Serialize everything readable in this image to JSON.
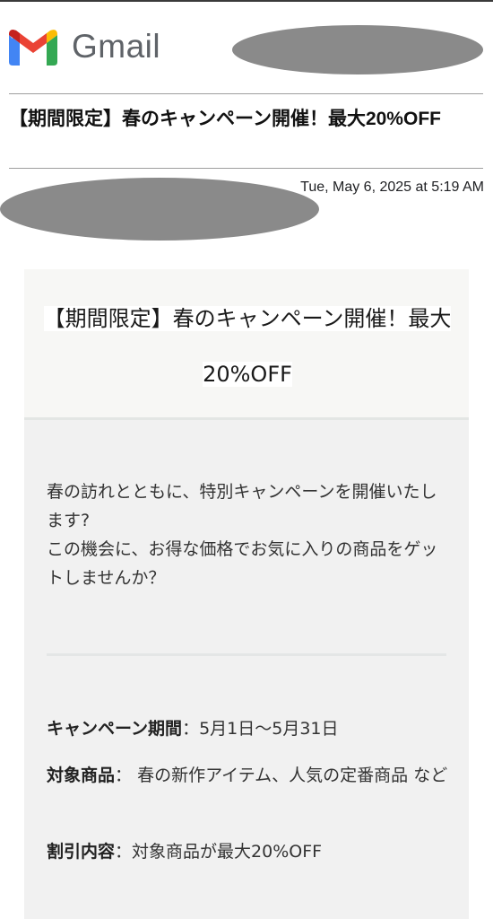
{
  "header": {
    "app_name": "Gmail"
  },
  "email": {
    "subject": "【期間限定】春のキャンペーン開催！最大20%OFF",
    "date": "Tue, May 6, 2025 at 5:19 AM"
  },
  "card": {
    "title": "【期間限定】春のキャンペーン開催！最大20%OFF",
    "intro_line1": "春の訪れとともに、特別キャンペーンを開催いたします?",
    "intro_line2": "この機会に、お得な価格でお気に入りの商品をゲットしませんか？",
    "details": [
      {
        "label": "キャンペーン期間",
        "sep": "：",
        "value": "5月1日〜5月31日"
      },
      {
        "label": "対象商品",
        "sep": "： ",
        "value": "春の新作アイテム、人気の定番商品 など"
      },
      {
        "label": "割引内容",
        "sep": "：",
        "value": "対象商品が最大20%OFF"
      }
    ]
  },
  "colors": {
    "gmail_red": "#EA4335",
    "gmail_blue": "#4285F4",
    "gmail_green": "#34A853",
    "gmail_yellow": "#FBBC04",
    "redaction": "#8a8a8a"
  },
  "icons": {
    "logo": "gmail-logo-icon"
  }
}
